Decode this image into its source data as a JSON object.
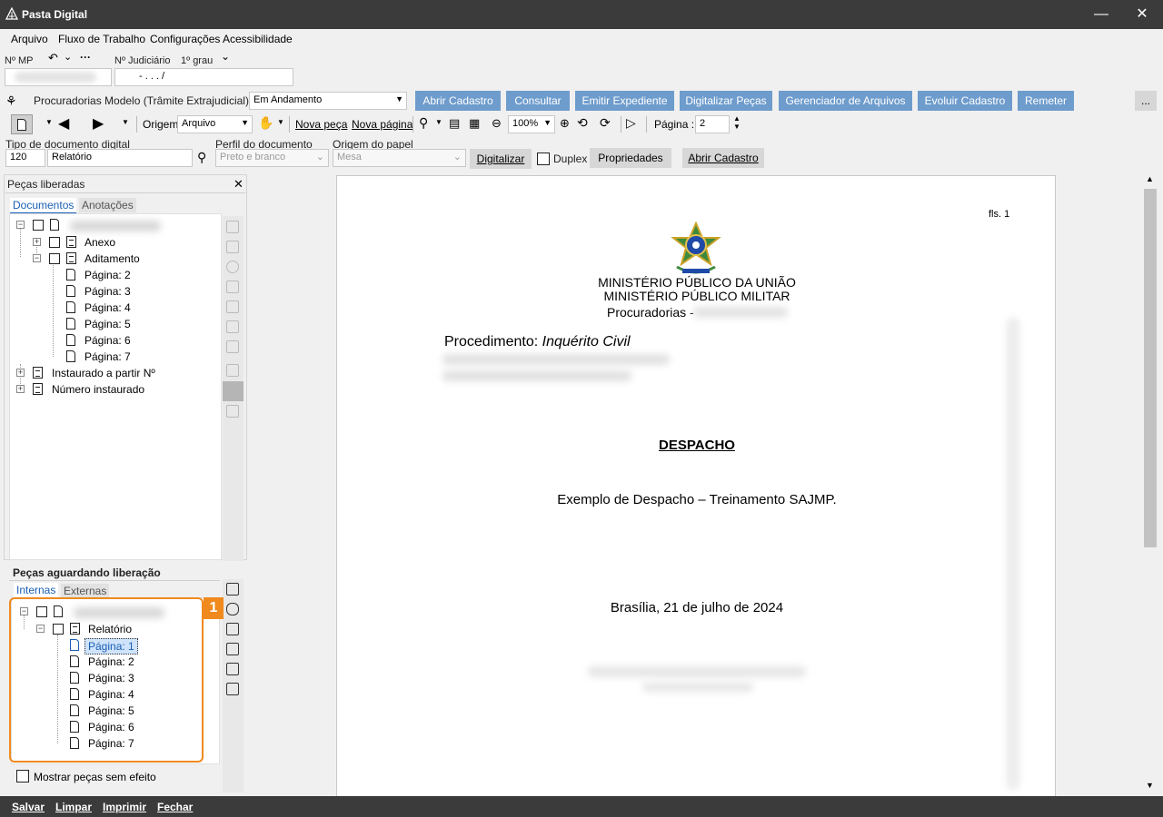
{
  "window": {
    "title": "Pasta Digital",
    "minimize_icon": "minimize-icon",
    "close_icon": "close-icon"
  },
  "menu": [
    {
      "label": "Arquivo"
    },
    {
      "label": "Fluxo de Trabalho"
    },
    {
      "label": "Configurações"
    },
    {
      "label": "Acessibilidade"
    }
  ],
  "header": {
    "mp_label": "Nº MP",
    "judiciario_label": "Nº Judiciário",
    "grau_label": "1º grau",
    "judiciario_value": "-   .   .   .   /"
  },
  "queue": {
    "label": "Procuradorias Modelo (Trâmite Extrajudicial) - Fila",
    "value": "Em Andamento"
  },
  "actions": [
    "Abrir Cadastro",
    "Consultar",
    "Emitir Expediente",
    "Digitalizar Peças",
    "Gerenciador de Arquivos",
    "Evoluir Cadastro",
    "Remeter"
  ],
  "more_label": "...",
  "toolbar": {
    "origem_label": "Origem",
    "origem_value": "Arquivo",
    "nova_peca": "Nova peça",
    "nova_pagina": "Nova página",
    "zoom": "100%",
    "pagina_label": "Página :",
    "pagina_value": "2"
  },
  "form": {
    "tipo_label": "Tipo de documento digital",
    "tipo_code": "120",
    "tipo_value": "Relatório",
    "perfil_label": "Perfil do documento",
    "perfil_value": "Preto e branco",
    "origem_papel_label": "Origem do papel",
    "origem_papel_value": "Mesa",
    "digitalizar": "Digitalizar",
    "duplex": "Duplex",
    "propriedades": "Propriedades",
    "abrir_cadastro": "Abrir Cadastro"
  },
  "released": {
    "title": "Peças liberadas",
    "tabs": [
      "Documentos",
      "Anotações"
    ],
    "items": {
      "anexo": "Anexo",
      "aditamento": "Aditamento",
      "pages": [
        "Página: 2",
        "Página: 3",
        "Página: 4",
        "Página: 5",
        "Página: 6",
        "Página: 7"
      ],
      "instaurado": "Instaurado a partir Nº",
      "numero": "Número instaurado"
    }
  },
  "pending": {
    "title": "Peças aguardando liberação",
    "tabs": [
      "Internas",
      "Externas"
    ],
    "relatorio": "Relatório",
    "pages": [
      "Página: 1",
      "Página: 2",
      "Página: 3",
      "Página: 4",
      "Página: 5",
      "Página: 6",
      "Página: 7"
    ],
    "show_no_effect": "Mostrar peças sem efeito"
  },
  "callout_number": "1",
  "document": {
    "fls": "fls. 1",
    "ministry1": "MINISTÉRIO PÚBLICO DA UNIÃO",
    "ministry2": "MINISTÉRIO PÚBLICO MILITAR",
    "procuradorias": "Procuradorias -",
    "procedimento_label": "Procedimento:",
    "procedimento_value": "Inquérito Civil",
    "heading": "DESPACHO",
    "body": "Exemplo de Despacho – Treinamento SAJMP.",
    "place_date": "Brasília, 21 de julho de 2024"
  },
  "footer": [
    "Salvar",
    "Limpar",
    "Imprimir",
    "Fechar"
  ],
  "colors": {
    "titlebar": "#3b3b3b",
    "action_blue": "#6e9ccc",
    "callout_orange": "#f08a1e"
  }
}
